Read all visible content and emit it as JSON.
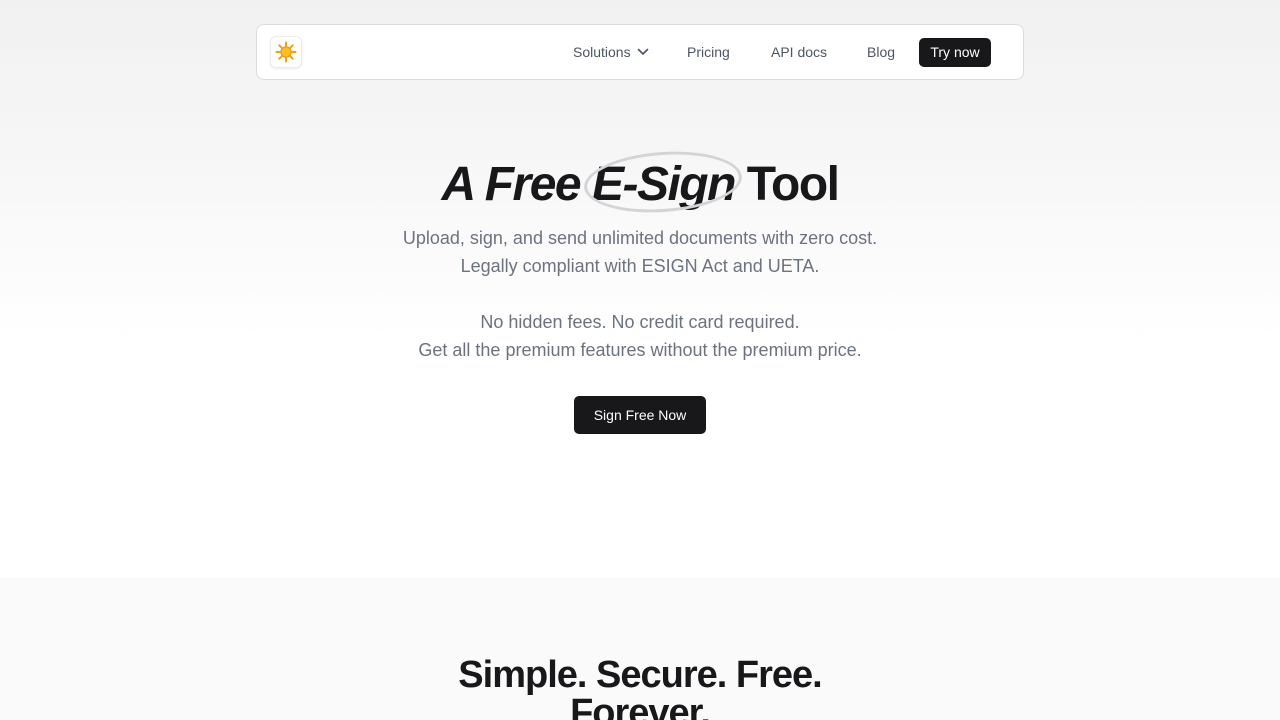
{
  "navbar": {
    "logo_icon": "sun-icon",
    "items": [
      {
        "label": "Solutions",
        "has_dropdown": true
      },
      {
        "label": "Pricing"
      },
      {
        "label": "API docs"
      },
      {
        "label": "Blog"
      }
    ],
    "cta_label": "Try now"
  },
  "hero": {
    "headline_part1": "A Free ",
    "headline_highlight": "E-Sign",
    "headline_part3": " Tool",
    "subtitle_line1": "Upload, sign, and send unlimited documents with zero cost.",
    "subtitle_line2": "Legally compliant with ESIGN Act and UETA.",
    "subtitle_line3": "No hidden fees. No credit card required.",
    "subtitle_line4": "Get all the premium features without the premium price.",
    "cta_label": "Sign Free Now"
  },
  "features": {
    "title_line1": "Simple. Secure. Free.",
    "title_line2": "Forever."
  },
  "colors": {
    "primary_button": "#18181b",
    "text_dark": "#18181b",
    "text_muted": "#6b7280",
    "sun": "#f59e0b"
  }
}
